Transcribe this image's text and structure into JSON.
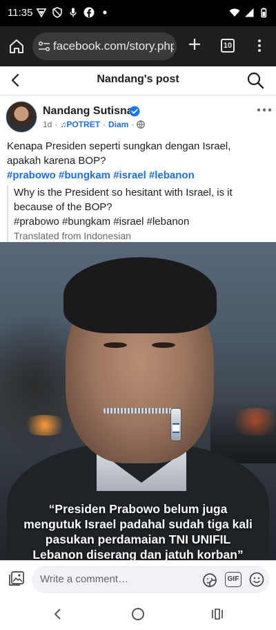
{
  "status_bar": {
    "time": "11:35"
  },
  "browser": {
    "url": "facebook.com/story.php",
    "tab_count": "10"
  },
  "header": {
    "title": "Nandang's post"
  },
  "post": {
    "author": "Nandang Sutisna",
    "time": "1d",
    "music_label": "♫POTRET",
    "music_extra": "Diam",
    "text_line1": "Kenapa Presiden seperti sungkan dengan Israel,",
    "text_line2": "apakah karena BOP?",
    "hashtags": "#prabowo #bungkam #israel #lebanon",
    "translation_line1": "Why is the President so hesitant with Israel, is it",
    "translation_line2": "because of the BOP?",
    "translation_hashtags": "#prabowo #bungkam #israel #lebanon",
    "translated_note": "Translated from Indonesian",
    "image_caption": "“Presiden Prabowo belum juga mengutuk Israel padahal sudah tiga kali pasukan perdamaian TNI UNIFIL Lebanon diserang dan jatuh korban”"
  },
  "comment": {
    "placeholder": "Write a comment…",
    "gif_label": "GIF"
  },
  "icons": {
    "home": "home-icon",
    "settings": "url-settings-icon",
    "plus": "plus-icon",
    "menu": "more-vert-icon",
    "back": "back-arrow-icon",
    "search": "search-icon",
    "verified": "verified-badge-icon",
    "globe": "globe-icon",
    "more": "more-horiz-icon",
    "photo": "photo-icon",
    "sticker": "sticker-icon",
    "emoji": "emoji-icon"
  },
  "colors": {
    "link": "#216fdb",
    "verified": "#1877f2"
  }
}
